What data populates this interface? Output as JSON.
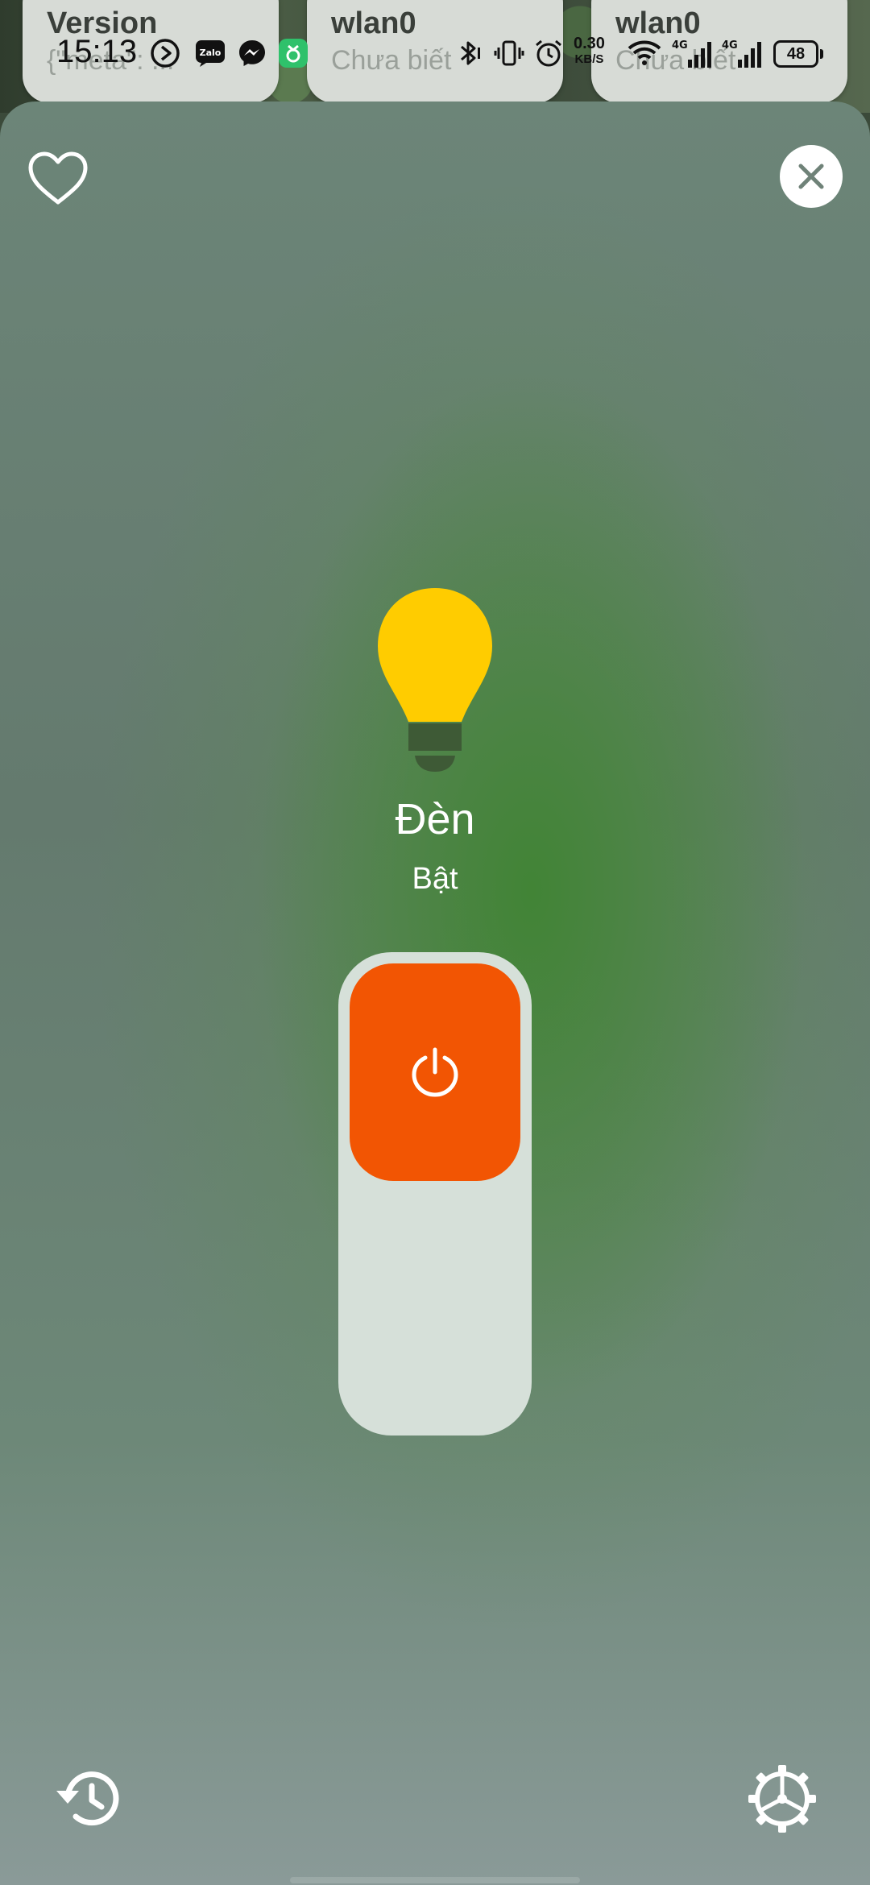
{
  "background_cards": [
    {
      "title": "Version",
      "subtitle": "{\"meta\": ..."
    },
    {
      "title": "wlan0",
      "subtitle": "Chưa biết"
    },
    {
      "title": "wlan0",
      "subtitle": "Chưa biết"
    }
  ],
  "status_bar": {
    "time": "15:13",
    "notification_icons": [
      "media-play-icon",
      "zalo-icon",
      "messenger-icon",
      "app-icon"
    ],
    "zalo_label": "Zalo",
    "net_speed": "0.30",
    "net_speed_unit": "KB/S",
    "network_1": "4G",
    "network_2": "4G",
    "battery": "48"
  },
  "dialog": {
    "device_name": "Đèn",
    "device_state": "Bật",
    "is_on": true,
    "bulb_color": "#FFCC00",
    "toggle_on_color": "#F25503"
  }
}
